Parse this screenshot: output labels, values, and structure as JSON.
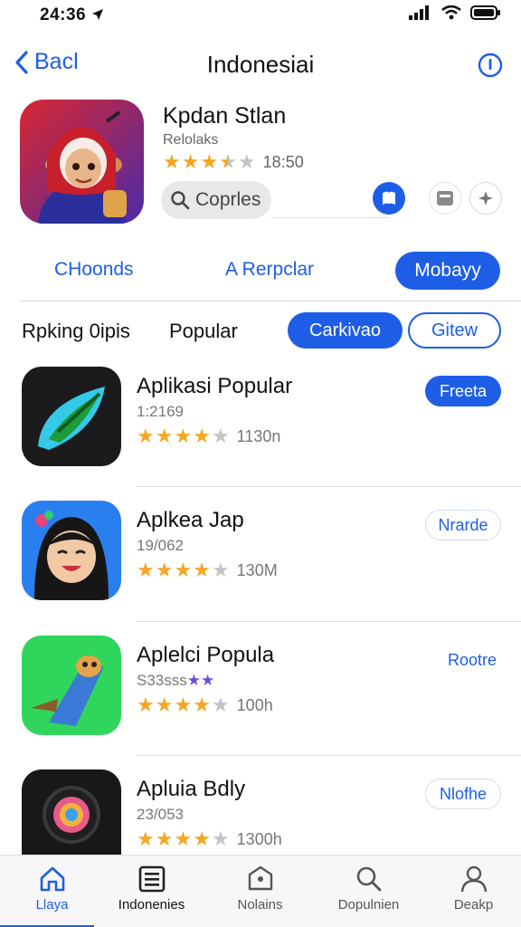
{
  "status": {
    "time": "24:36"
  },
  "nav": {
    "back_label": "Bacl",
    "title": "Indonesiai"
  },
  "hero": {
    "title": "Kpdan Stlan",
    "subtitle": "Relolaks",
    "rating_value": 3.5,
    "rating_text": "18:50",
    "search_label": "Coprles"
  },
  "segments": {
    "items": [
      "CHoonds",
      "A Rerpclar"
    ],
    "active": "Mobayy"
  },
  "filters": {
    "label1": "Rpking 0ipis",
    "label2": "Popular",
    "chip_solid": "Carkivao",
    "chip_outline": "Gitew"
  },
  "apps": [
    {
      "name": "Aplikasi Popular",
      "sub": "1:2169",
      "rating": 4,
      "rating_text": "1130n",
      "button": "Freeta",
      "button_style": "solid"
    },
    {
      "name": "Aplkea Jap",
      "sub": "19/062",
      "rating": 4,
      "rating_text": "130M",
      "button": "Nrarde",
      "button_style": "outline"
    },
    {
      "name": "Aplelci Popula",
      "sub": "S33sss",
      "rating": 4,
      "rating_text": "100h",
      "button": "Rootre",
      "button_style": "plain"
    },
    {
      "name": "Apluia Bdly",
      "sub": "23/053",
      "rating": 4,
      "rating_text": "1300h",
      "button": "Nlofhe",
      "button_style": "outline"
    }
  ],
  "tabs": [
    {
      "label": "Llaya",
      "icon": "home-icon"
    },
    {
      "label": "Indonenies",
      "icon": "list-icon"
    },
    {
      "label": "Nolains",
      "icon": "tag-icon"
    },
    {
      "label": "Dopulnien",
      "icon": "search-icon"
    },
    {
      "label": "Deakp",
      "icon": "profile-icon"
    }
  ],
  "colors": {
    "accent": "#1e5ee6",
    "star": "#f5a623"
  }
}
